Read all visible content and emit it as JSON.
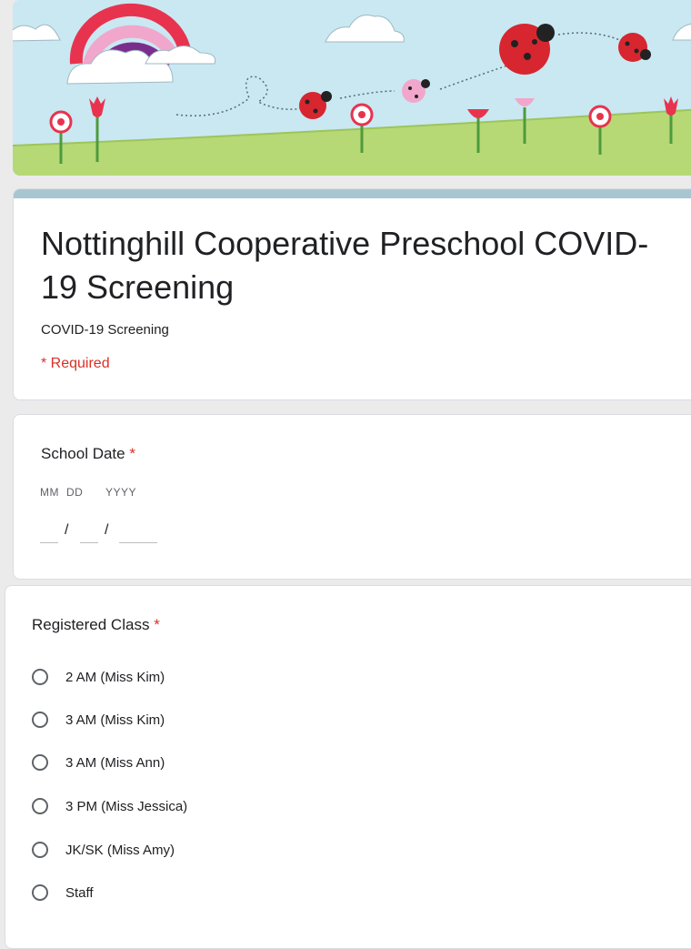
{
  "form": {
    "title": "Nottinghill Cooperative Preschool COVID-19 Screening",
    "description": "COVID-19 Screening",
    "required_note": "* Required"
  },
  "school_date": {
    "label": "School Date",
    "required_mark": "*",
    "labels": {
      "month": "MM",
      "day": "DD",
      "year": "YYYY"
    },
    "separator": "/",
    "values": {
      "month": "",
      "day": "",
      "year": ""
    }
  },
  "registered_class": {
    "label": "Registered Class",
    "required_mark": "*",
    "options": [
      "2 AM (Miss Kim)",
      "3 AM (Miss Kim)",
      "3 AM (Miss Ann)",
      "3 PM (Miss Jessica)",
      "JK/SK (Miss Amy)",
      "Staff"
    ]
  },
  "colors": {
    "accent_bar": "#a8c6d1",
    "required": "#d93025",
    "page_bg": "#ebebeb"
  }
}
